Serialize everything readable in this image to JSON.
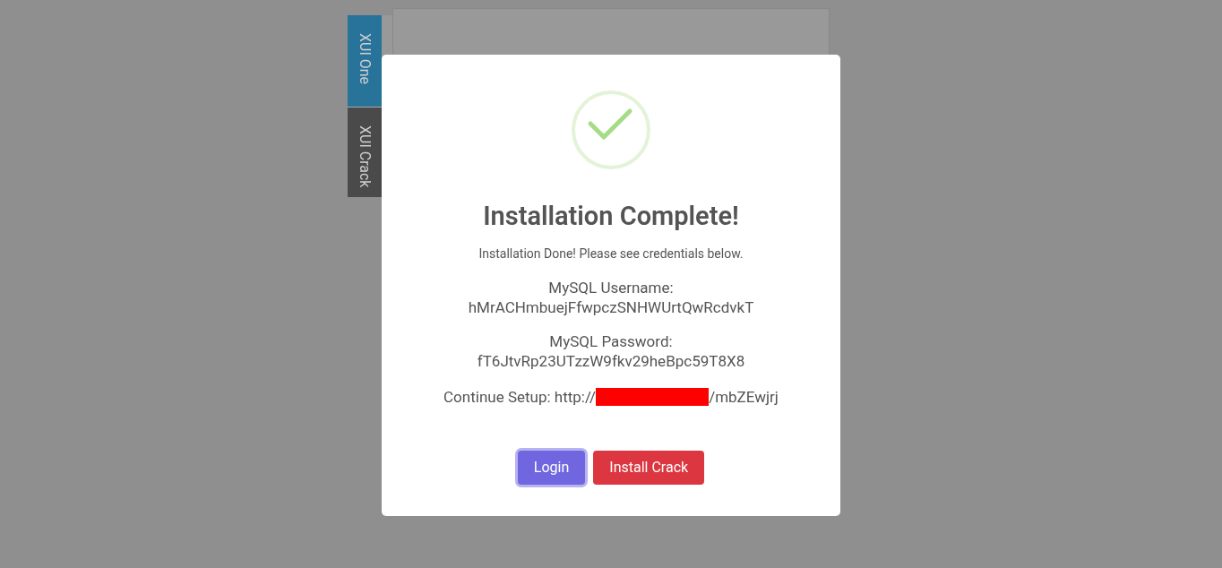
{
  "side_tabs": [
    {
      "label": "XUI One",
      "selected": true
    },
    {
      "label": "XUI Crack",
      "selected": false
    }
  ],
  "modal": {
    "title": "Installation Complete!",
    "message": "Installation Done! Please see credentials below.",
    "credentials": [
      {
        "label": "MySQL Username:",
        "value": "hMrACHmbuejFfwpczSNHWUrtQwRcdvkT"
      },
      {
        "label": "MySQL Password:",
        "value": "fT6JtvRp23UTzzW9fkv29heBpc59T8X8"
      }
    ],
    "continue": {
      "prefix": "Continue Setup: http://",
      "suffix": "/mbZEwjrj"
    },
    "buttons": [
      {
        "label": "Login",
        "kind": "primary",
        "focused": true
      },
      {
        "label": "Install Crack",
        "kind": "danger",
        "focused": false
      }
    ]
  }
}
